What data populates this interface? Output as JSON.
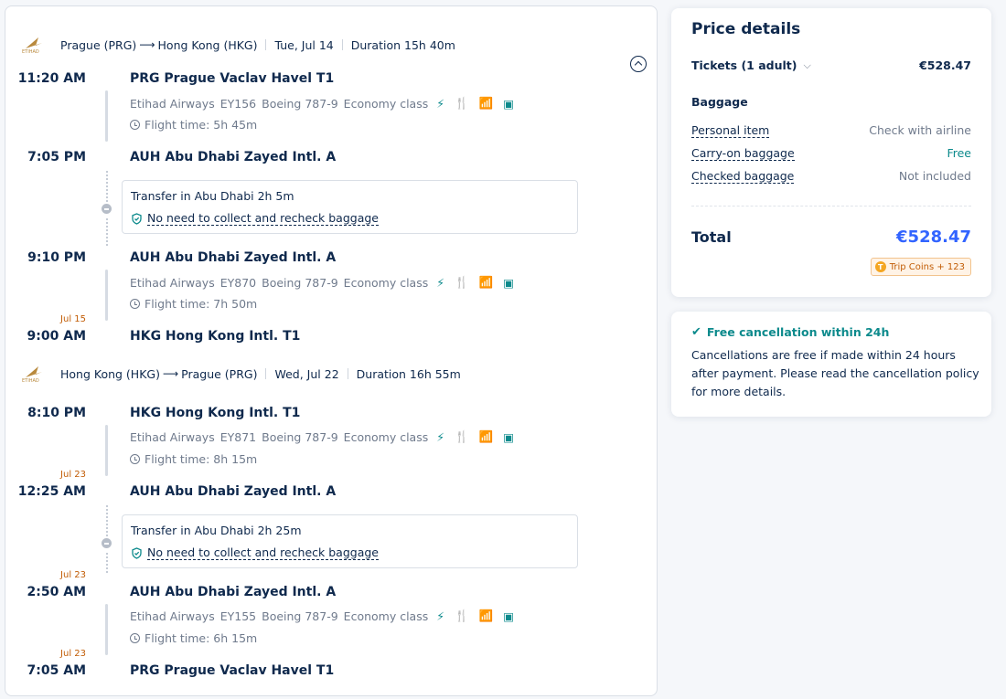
{
  "outbound": {
    "header": {
      "from": "Prague (PRG)",
      "to": "Hong Kong (HKG)",
      "date": "Tue, Jul 14",
      "duration": "Duration 15h 40m"
    },
    "seg1": {
      "dep_time": "11:20 AM",
      "dep_airport": "PRG Prague Vaclav Havel T1",
      "airline": "Etihad Airways",
      "flight": "EY156",
      "aircraft": "Boeing 787-9",
      "cabin": "Economy class",
      "flight_time": "Flight time: 5h 45m",
      "arr_time": "7:05 PM",
      "arr_airport": "AUH Abu Dhabi Zayed Intl. A"
    },
    "transfer": {
      "text": "Transfer in Abu Dhabi  2h 5m",
      "baggage": "No need to collect and recheck baggage"
    },
    "seg2": {
      "dep_time": "9:10 PM",
      "dep_airport": "AUH Abu Dhabi Zayed Intl. A",
      "airline": "Etihad Airways",
      "flight": "EY870",
      "aircraft": "Boeing 787-9",
      "cabin": "Economy class",
      "flight_time": "Flight time: 7h 50m",
      "arr_date": "Jul 15",
      "arr_time": "9:00 AM",
      "arr_airport": "HKG Hong Kong Intl. T1"
    }
  },
  "inbound": {
    "header": {
      "from": "Hong Kong (HKG)",
      "to": "Prague (PRG)",
      "date": "Wed, Jul 22",
      "duration": "Duration 16h 55m"
    },
    "seg1": {
      "dep_time": "8:10 PM",
      "dep_airport": "HKG Hong Kong Intl. T1",
      "airline": "Etihad Airways",
      "flight": "EY871",
      "aircraft": "Boeing 787-9",
      "cabin": "Economy class",
      "flight_time": "Flight time: 8h 15m",
      "arr_date": "Jul 23",
      "arr_time": "12:25 AM",
      "arr_airport": "AUH Abu Dhabi Zayed Intl. A"
    },
    "transfer": {
      "text": "Transfer in Abu Dhabi  2h 25m",
      "baggage": "No need to collect and recheck baggage"
    },
    "seg2": {
      "dep_date": "Jul 23",
      "dep_time": "2:50 AM",
      "dep_airport": "AUH Abu Dhabi Zayed Intl. A",
      "airline": "Etihad Airways",
      "flight": "EY155",
      "aircraft": "Boeing 787-9",
      "cabin": "Economy class",
      "flight_time": "Flight time: 6h 15m",
      "arr_date": "Jul 23",
      "arr_time": "7:05 AM",
      "arr_airport": "PRG Prague Vaclav Havel T1"
    }
  },
  "price": {
    "title": "Price details",
    "tickets_label": "Tickets  (1 adult)",
    "tickets_value": "€528.47",
    "baggage_title": "Baggage",
    "personal_label": "Personal item",
    "personal_value": "Check with airline",
    "carryon_label": "Carry-on baggage",
    "carryon_value": "Free",
    "checked_label": "Checked baggage",
    "checked_value": "Not included",
    "total_label": "Total",
    "total_value": "€528.47",
    "coins": "Trip Coins + 123"
  },
  "cancellation": {
    "title": "Free cancellation within 24h",
    "body": "Cancellations are free if made within 24 hours after payment. Please read the cancellation policy for more details."
  },
  "colors": {
    "brand_blue": "#3264ff",
    "teal": "#0c8a8c",
    "orange": "#c25d06",
    "text": "#0f294d"
  }
}
